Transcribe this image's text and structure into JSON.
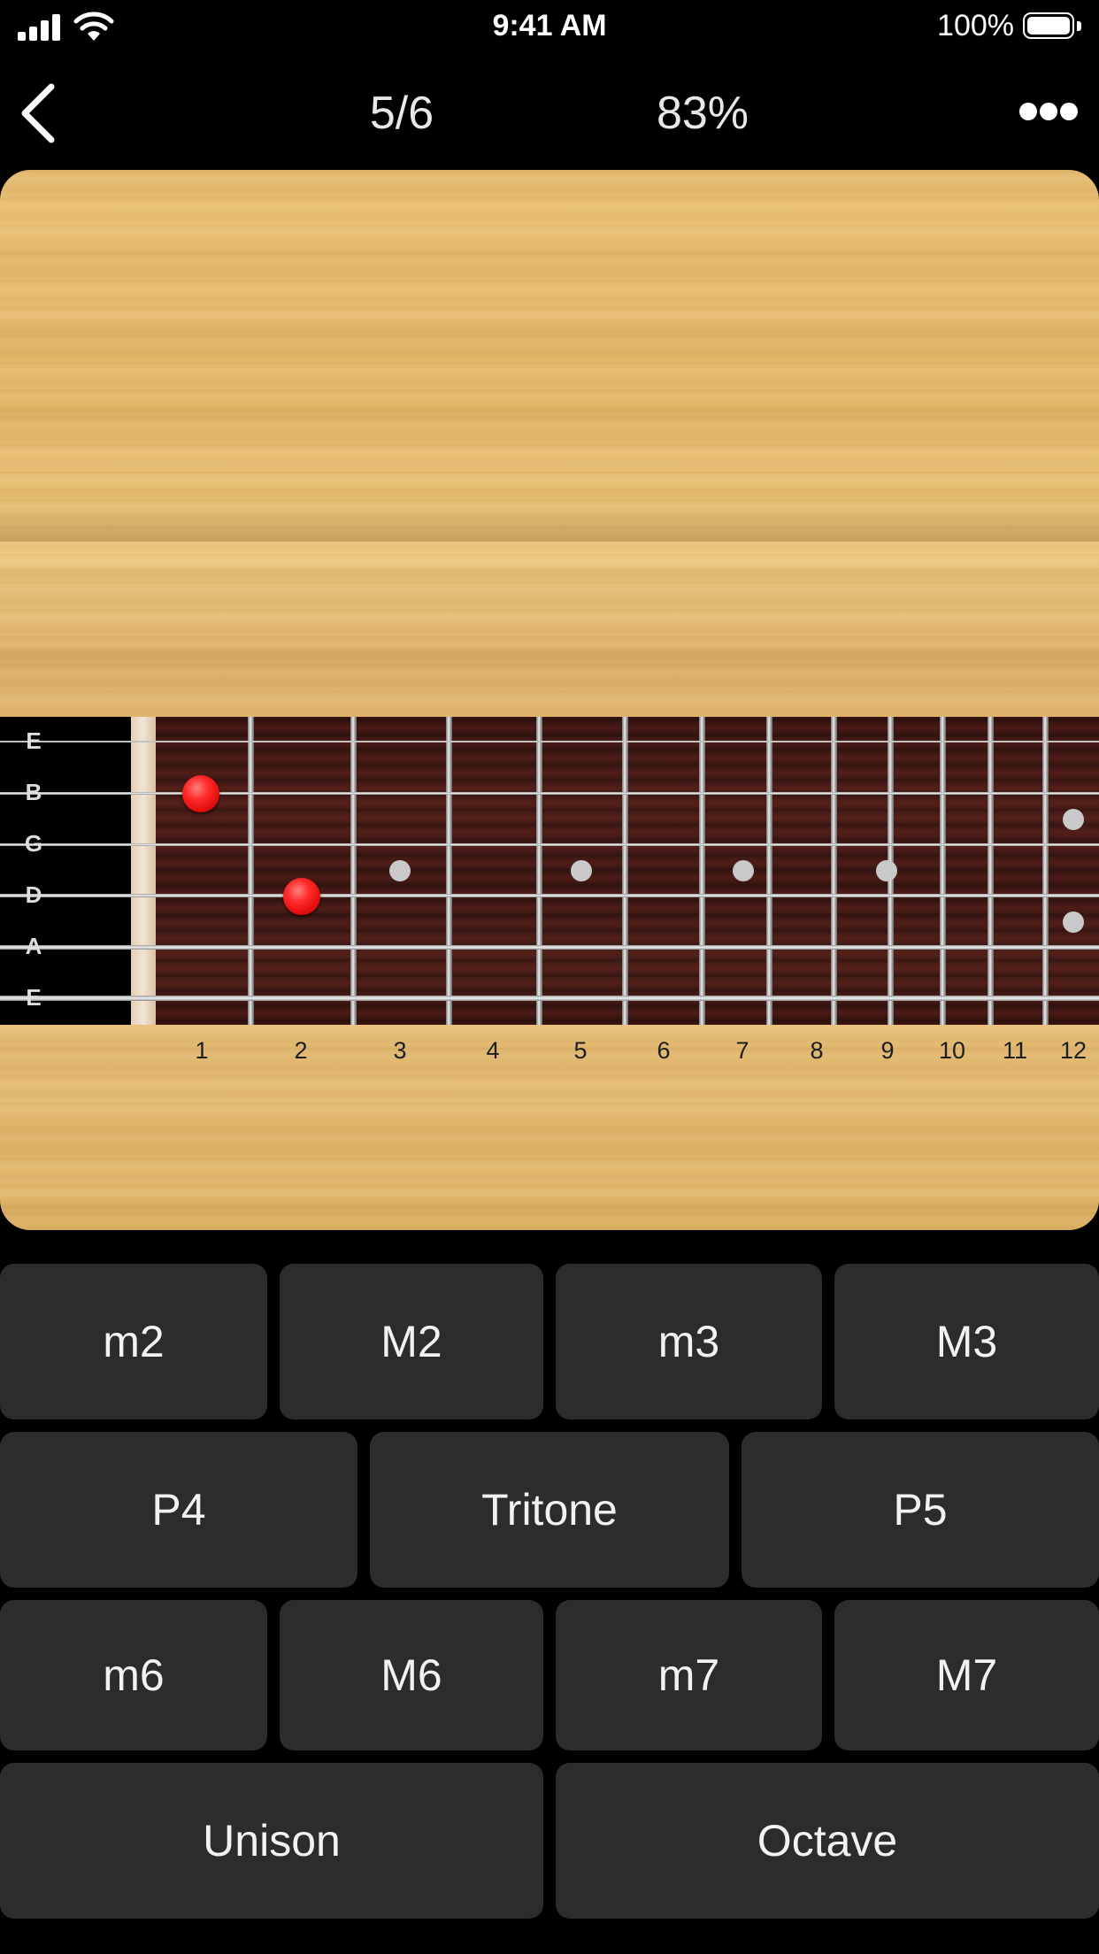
{
  "status_bar": {
    "time": "9:41 AM",
    "battery": "100%"
  },
  "nav": {
    "progress": "5/6",
    "score": "83%"
  },
  "fretboard": {
    "strings": [
      "E",
      "B",
      "G",
      "D",
      "A",
      "E"
    ],
    "fret_numbers": [
      "1",
      "2",
      "3",
      "4",
      "5",
      "6",
      "7",
      "8",
      "9",
      "10",
      "11",
      "12"
    ],
    "marked_notes": [
      {
        "string": "B",
        "fret": 1
      },
      {
        "string": "D",
        "fret": 2
      }
    ]
  },
  "answers": {
    "row1": [
      "m2",
      "M2",
      "m3",
      "M3"
    ],
    "row2": [
      "P4",
      "Tritone",
      "P5"
    ],
    "row3": [
      "m6",
      "M6",
      "m7",
      "M7"
    ],
    "row4": [
      "Unison",
      "Octave"
    ]
  },
  "colors": {
    "marker": "#ff2a2a",
    "button_bg": "#2c2c2e",
    "wood": "#e5ba6e"
  }
}
